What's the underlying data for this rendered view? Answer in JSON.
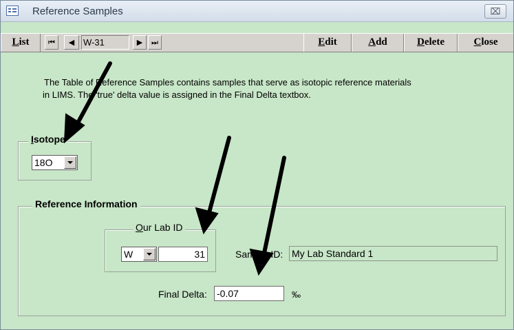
{
  "window": {
    "title": "Reference Samples",
    "close_symbol": "⌧"
  },
  "toolbar": {
    "list_first": "L",
    "list_rest": "ist",
    "nav_first_symbol": "⏮",
    "nav_prev_symbol": "◀",
    "record_value": "W-31",
    "nav_next_symbol": "▶",
    "nav_last_symbol": "⏭",
    "edit_first": "E",
    "edit_rest": "dit",
    "add_first": "A",
    "add_rest": "dd",
    "delete_first": "D",
    "delete_rest": "elete",
    "close_first": "C",
    "close_rest": "lose"
  },
  "instructions": {
    "line1": "The Table of Reference Samples contains samples that serve as isotopic reference materials",
    "line2": "in LIMS.  The 'true' delta value is assigned in the Final Delta textbox."
  },
  "isotope": {
    "label_first": "I",
    "label_rest": "sotope",
    "value": "18O"
  },
  "reference_info": {
    "label": "Reference Information",
    "our_lab_id": {
      "label_first": "O",
      "label_rest": "ur Lab ID",
      "prefix": "W",
      "number": "31"
    },
    "sample_id_label": "Sample ID:",
    "sample_id_value": "My Lab Standard 1",
    "final_delta_label": "Final Delta:",
    "final_delta_value": "-0.07",
    "unit": "‰"
  },
  "colors": {
    "form_background": "#c8e6c8",
    "toolbar_background": "#d6d3ce"
  }
}
